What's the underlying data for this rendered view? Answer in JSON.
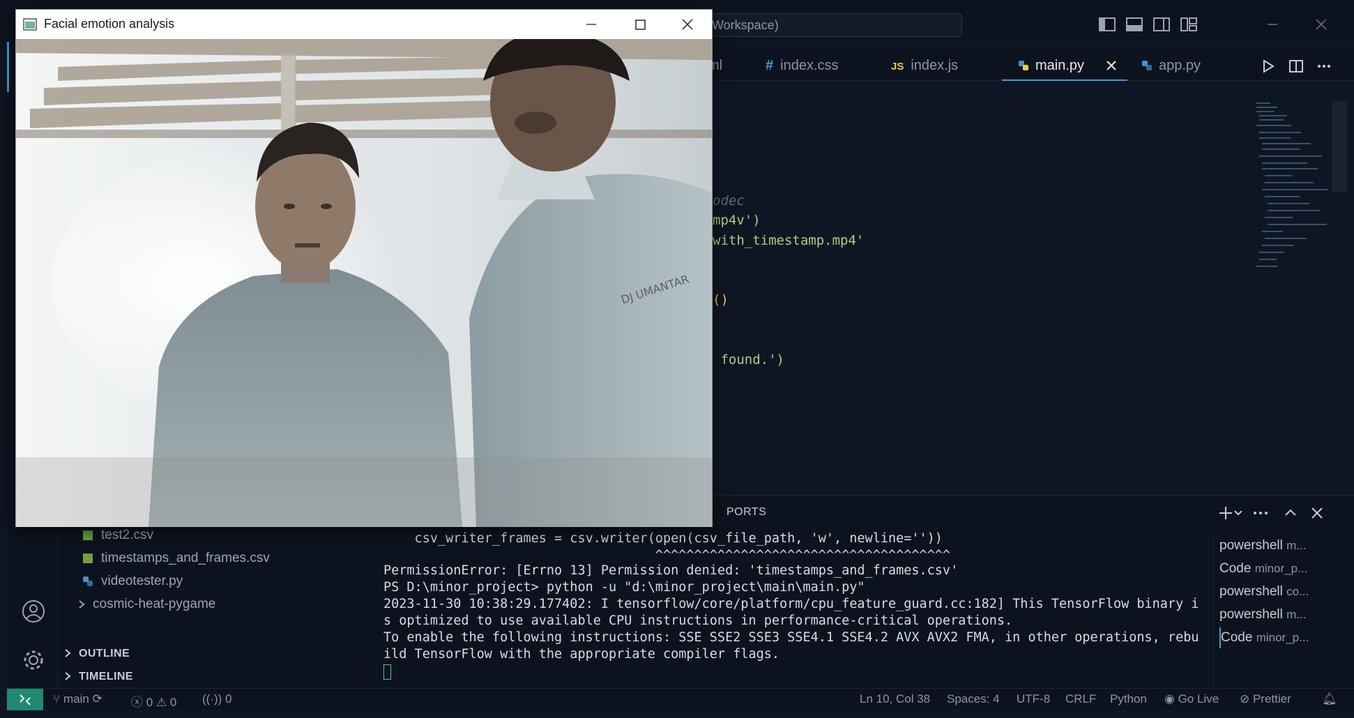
{
  "camera_window": {
    "title": "Facial emotion analysis",
    "icon": "app-window-icon",
    "minimize": "minimize-icon",
    "maximize": "maximize-icon",
    "close": "close-icon"
  },
  "vscode": {
    "command_center_text": "Workspace)",
    "tabs": [
      {
        "label": "ml",
        "icon_text": ""
      },
      {
        "label": "index.css",
        "icon_text": "#"
      },
      {
        "label": "index.js",
        "icon_text": "JS"
      },
      {
        "label": "main.py",
        "icon_text": "py",
        "active": true
      },
      {
        "label": "app.py",
        "icon_text": "py"
      }
    ],
    "editor_lines": [
      {
        "text": "odec",
        "kind": "comment"
      },
      {
        "text": "mp4v')",
        "kind": "string"
      },
      {
        "text": "with_timestamp.mp4'",
        "kind": "string"
      },
      {
        "text": "()",
        "kind": "paren"
      },
      {
        "text": " found.')",
        "kind": "string"
      }
    ],
    "panel": {
      "tab": "PORTS",
      "terminal_lines": [
        "    csv_writer_frames = csv.writer(open(csv_file_path, 'w', newline=''))",
        "                                   ^^^^^^^^^^^^^^^^^^^^^^^^^^^^^^^^^^^^^^",
        "PermissionError: [Errno 13] Permission denied: 'timestamps_and_frames.csv'",
        "PS D:\\minor_project> python -u \"d:\\minor_project\\main\\main.py\"",
        "2023-11-30 10:38:29.177402: I tensorflow/core/platform/cpu_feature_guard.cc:182] This TensorFlow binary i",
        "s optimized to use available CPU instructions in performance-critical operations.",
        "To enable the following instructions: SSE SSE2 SSE3 SSE4.1 SSE4.2 AVX AVX2 FMA, in other operations, rebu",
        "ild TensorFlow with the appropriate compiler flags."
      ],
      "terminals": [
        {
          "name": "powershell",
          "sub": "m..."
        },
        {
          "name": "Code",
          "sub": "minor_p..."
        },
        {
          "name": "powershell",
          "sub": "co..."
        },
        {
          "name": "powershell",
          "sub": "m..."
        },
        {
          "name": "Code",
          "sub": "minor_p..."
        }
      ]
    },
    "explorer": {
      "files": [
        {
          "name": "test2.csv",
          "icon": "csv-file-icon"
        },
        {
          "name": "timestamps_and_frames.csv",
          "icon": "csv-file-icon"
        },
        {
          "name": "videotester.py",
          "icon": "python-file-icon"
        },
        {
          "name": "cosmic-heat-pygame",
          "icon": "chevron-right-icon"
        }
      ],
      "sections": [
        "OUTLINE",
        "TIMELINE"
      ]
    },
    "statusbar": {
      "branch": "main",
      "errors": "0",
      "warnings": "0",
      "ports": "0",
      "position": "Ln 10, Col 38",
      "spaces": "Spaces: 4",
      "encoding": "UTF-8",
      "eol": "CRLF",
      "language": "Python",
      "golive": "Go Live",
      "prettier": "Prettier"
    }
  }
}
